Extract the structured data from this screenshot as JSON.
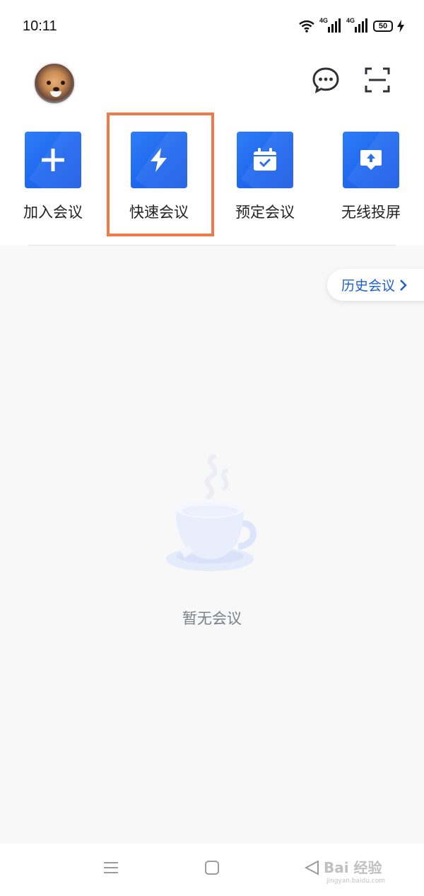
{
  "status_bar": {
    "time": "10:11",
    "signal_1": "4G",
    "signal_2": "4G",
    "battery": "50"
  },
  "header": {
    "avatar_icon": "dog-avatar",
    "message_icon": "chat-bubble-icon",
    "scan_icon": "scan-icon"
  },
  "actions": [
    {
      "label": "加入会议",
      "icon": "plus-icon"
    },
    {
      "label": "快速会议",
      "icon": "lightning-icon"
    },
    {
      "label": "预定会议",
      "icon": "calendar-check-icon"
    },
    {
      "label": "无线投屏",
      "icon": "screen-cast-icon"
    }
  ],
  "history_button": {
    "label": "历史会议"
  },
  "empty_state": {
    "text": "暂无会议",
    "icon": "coffee-cup-icon"
  },
  "nav": {
    "menu_icon": "menu-icon",
    "home_icon": "home-icon",
    "back_icon": "back-icon"
  },
  "watermark": {
    "main": "Bai 经验",
    "sub": "jingyan.baidu.com"
  },
  "colors": {
    "tile_blue": "#1e66ee",
    "highlight_orange": "#f07a47",
    "history_text": "#1e5fd1",
    "page_background": "#f8f8f9"
  }
}
